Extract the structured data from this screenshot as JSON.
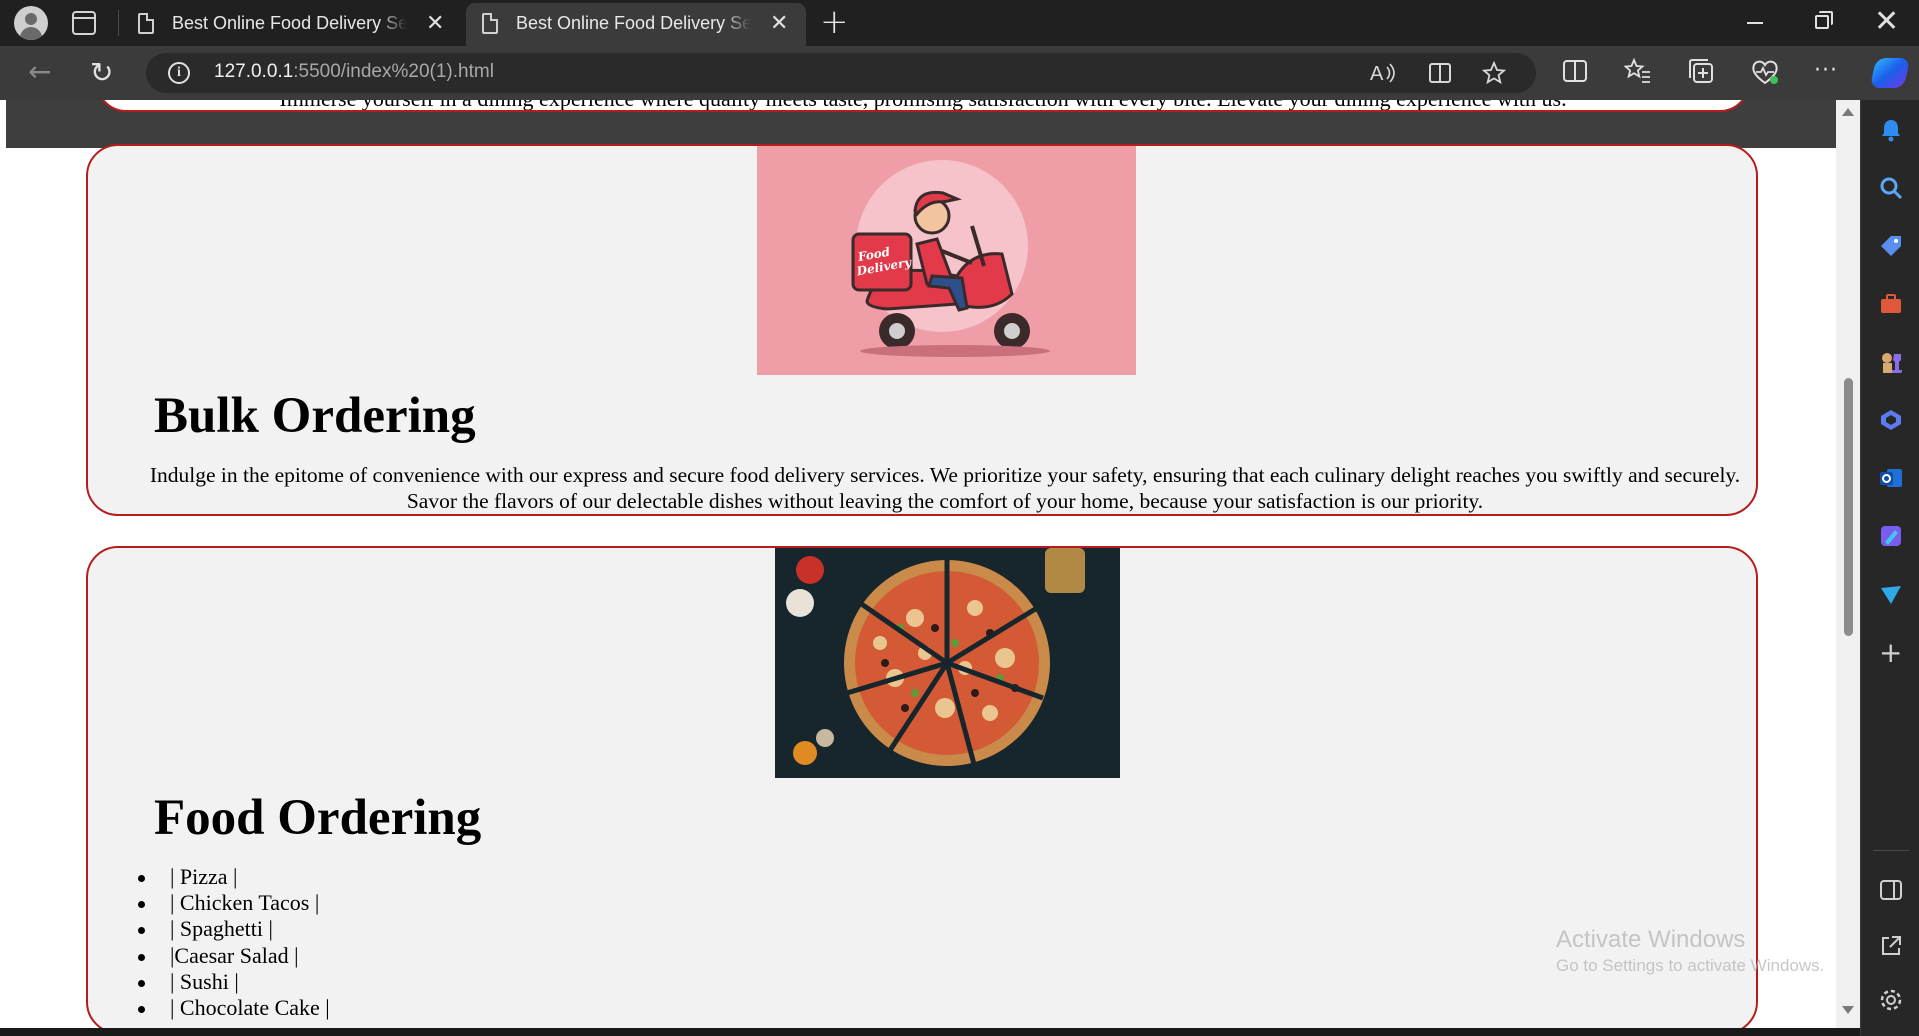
{
  "browser": {
    "tabs": [
      {
        "title": "Best Online Food Delivery Servic",
        "close": "✕"
      },
      {
        "title": "Best Online Food Delivery Servic",
        "close": "✕"
      }
    ],
    "new_tab": "+",
    "window_controls": {
      "minimize": "",
      "maximize": "",
      "close": "✕"
    },
    "url_host": "127.0.0.1",
    "url_path": ":5500/index%20(1).html",
    "back_glyph": "←",
    "refresh_glyph": "↻",
    "more_glyph": "···"
  },
  "page": {
    "previous_section_text": "Immerse yourself in a dining experience where quality meets taste, promising satisfaction with every bite. Elevate your dining experience with us.",
    "bulk": {
      "image_text": "Food Delivery",
      "heading": "Bulk Ordering",
      "description": "Indulge in the epitome of convenience with our express and secure food delivery services. We prioritize your safety, ensuring that each culinary delight reaches you swiftly and securely. Savor the flavors of our delectable dishes without leaving the comfort of your home, because your satisfaction is our priority."
    },
    "food": {
      "heading": "Food Ordering",
      "items": [
        "| Pizza |",
        "| Chicken Tacos |",
        "| Spaghetti |",
        "|Caesar Salad |",
        "| Sushi |",
        "| Chocolate Cake |"
      ]
    }
  },
  "watermark": {
    "line1": "Activate Windows",
    "line2": "Go to Settings to activate Windows."
  },
  "colors": {
    "card_border": "#b71c1c",
    "card_bg": "#f2f2f2",
    "delivery_bg": "#ef9ea8"
  }
}
